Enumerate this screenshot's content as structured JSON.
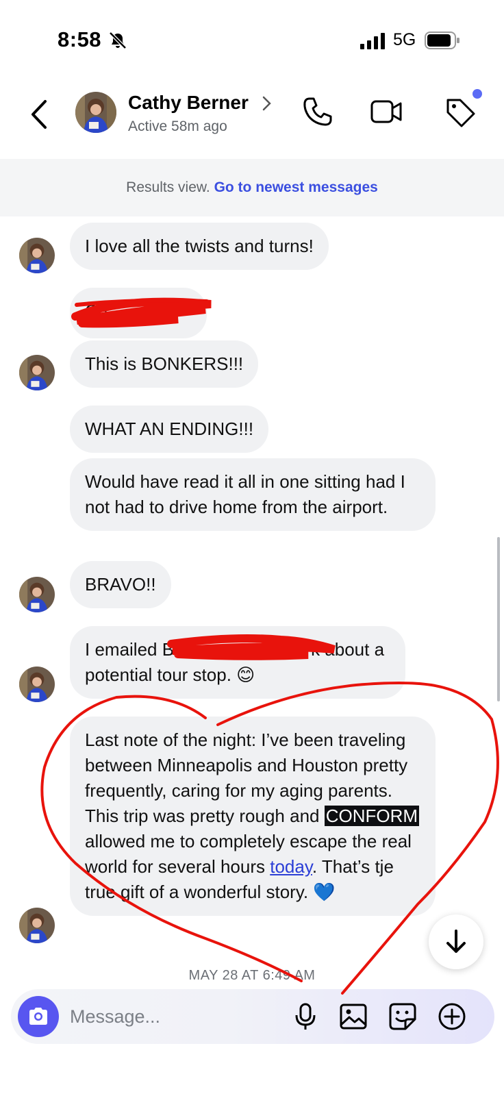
{
  "status_bar": {
    "time": "8:58",
    "network": "5G"
  },
  "header": {
    "contact_name": "Cathy Berner",
    "active_status": "Active 58m ago"
  },
  "results_banner": {
    "text": "Results view.",
    "link": "Go to newest messages"
  },
  "messages": [
    {
      "text": "I love all the twists and turns!"
    },
    {
      "text": "Ch"
    },
    {
      "text": "This is BONKERS!!!"
    },
    {
      "text": "WHAT AN ENDING!!!"
    },
    {
      "text": "Would have read it all in one sitting had I not had to drive home from the airport."
    },
    {
      "text": "BRAVO!!"
    },
    {
      "part1": "I emailed B",
      "part2": "k about a potential tour stop. 😊"
    },
    {
      "part1": "Last note of the night: I’ve been traveling between Minneapolis and Houston pretty frequently, caring for my aging parents. This trip was pretty rough and ",
      "highlight": "CONFORM",
      "part2": " allowed me to completely escape the real world for several hours ",
      "link": "today",
      "part3": ". That’s tje true gift of a wonderful story. 💙"
    }
  ],
  "timestamp": "MAY 28 AT 6:49 AM",
  "composer": {
    "placeholder": "Message..."
  },
  "colors": {
    "accent": "#5856f0",
    "link": "#3b4fe0",
    "bubble": "#f0f1f3",
    "annotation": "#e8130c"
  }
}
